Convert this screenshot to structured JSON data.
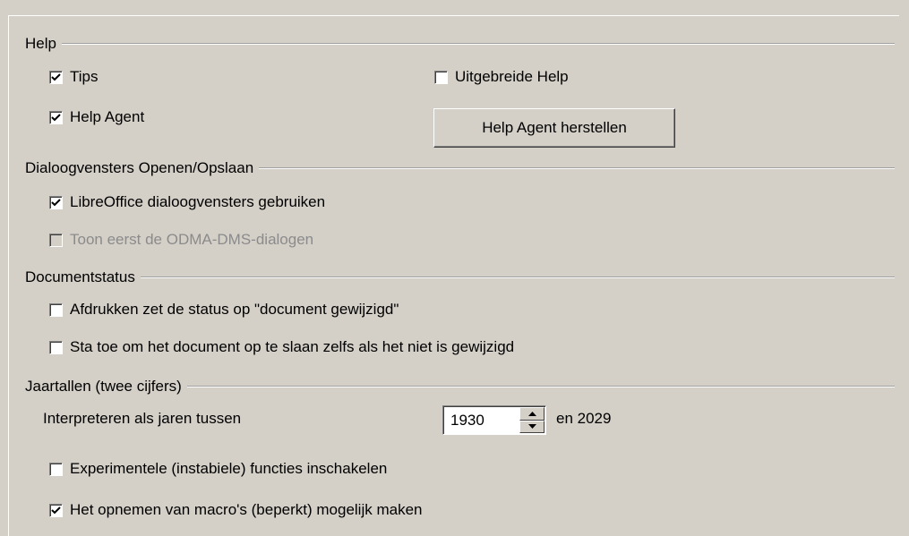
{
  "help": {
    "section_title": "Help",
    "tips": {
      "label": "Tips",
      "checked": true
    },
    "extended_help": {
      "label": "Uitgebreide Help",
      "checked": false
    },
    "help_agent": {
      "label": "Help Agent",
      "checked": true
    },
    "reset_help_agent_button": "Help Agent herstellen"
  },
  "dialogs": {
    "section_title": "Dialoogvensters Openen/Opslaan",
    "use_libreoffice_dialogs": {
      "label": "LibreOffice dialoogvensters gebruiken",
      "checked": true
    },
    "show_odma_first": {
      "label": "Toon eerst de ODMA-DMS-dialogen",
      "checked": false,
      "disabled": true
    }
  },
  "document_status": {
    "section_title": "Documentstatus",
    "printing_sets_modified": {
      "label": "Afdrukken zet de status op \"document gewijzigd\"",
      "checked": false
    },
    "allow_save_unmodified": {
      "label": "Sta toe om het document op te slaan zelfs als het niet is gewijzigd",
      "checked": false
    }
  },
  "year": {
    "section_title": "Jaartallen (twee cijfers)",
    "interpret_label": "Interpreteren als jaren tussen",
    "start_year": "1930",
    "end_label": "en 2029"
  },
  "experimental": {
    "label": "Experimentele (instabiele) functies inschakelen",
    "checked": false
  },
  "macro_recording": {
    "label": "Het opnemen van macro's (beperkt) mogelijk maken",
    "checked": true
  },
  "colors": {
    "background": "#d4d0c8",
    "disabled_text": "#8b8b8b"
  }
}
